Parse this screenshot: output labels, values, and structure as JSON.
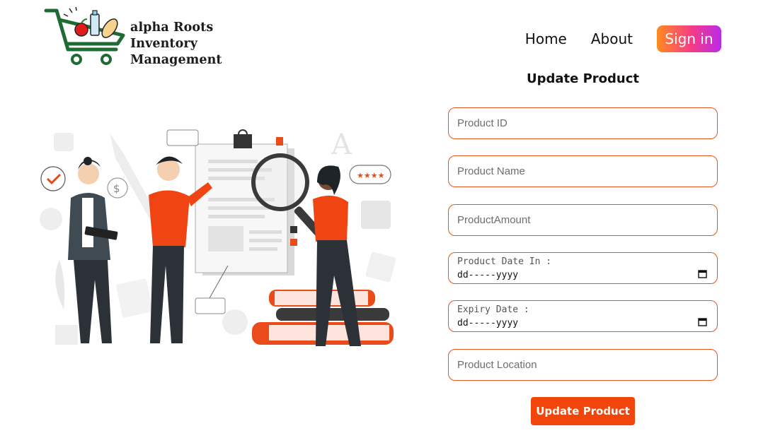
{
  "brand": {
    "line1": "alpha Roots",
    "line2": "Inventory Management"
  },
  "nav": {
    "home": "Home",
    "about": "About",
    "signin": "Sign in"
  },
  "form": {
    "title": "Update Product",
    "product_id_placeholder": "Product ID",
    "product_name_placeholder": "Product Name",
    "product_amount_placeholder": "ProductAmount",
    "date_in_label": "Product Date In :",
    "date_in_value": "dd-----yyyy",
    "expiry_label": "Expiry Date :",
    "expiry_value": "dd-----yyyy",
    "location_placeholder": "Product Location",
    "submit_label": "Update Product"
  },
  "illustration": {
    "rating_stars": "★★★★"
  },
  "colors": {
    "accent": "#f1450c",
    "border": "#e7541f",
    "cart_green": "#1f6b34"
  }
}
